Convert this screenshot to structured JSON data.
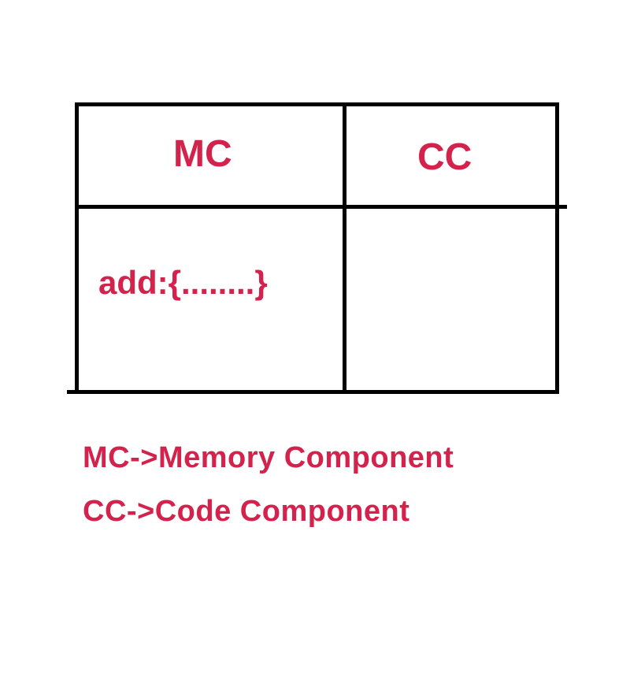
{
  "table": {
    "headers": {
      "left": "MC",
      "right": "CC"
    },
    "cells": {
      "bottomLeft": "add:{........}",
      "bottomRight": ""
    }
  },
  "legend": {
    "line1": "MC->Memory Component",
    "line2": "CC->Code Component"
  }
}
